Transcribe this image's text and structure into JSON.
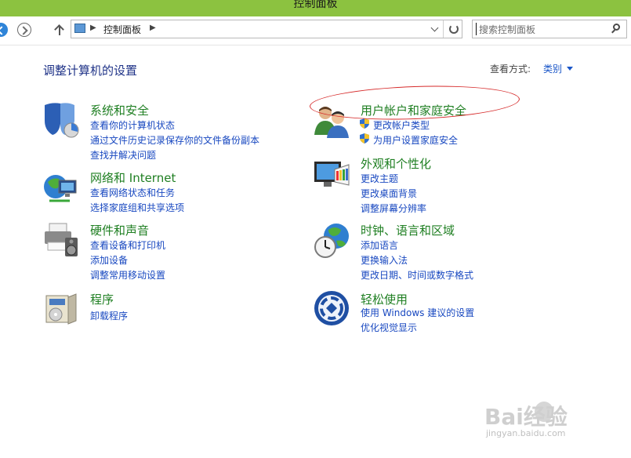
{
  "window": {
    "title": "控制面板"
  },
  "addressbar": {
    "breadcrumb": "控制面板",
    "search_placeholder": "搜索控制面板"
  },
  "page": {
    "heading": "调整计算机的设置",
    "view_by_label": "查看方式:",
    "view_by_value": "类别"
  },
  "categories": {
    "system_security": {
      "title": "系统和安全",
      "icon": "shield-icon",
      "links": [
        "查看你的计算机状态",
        "通过文件历史记录保存你的文件备份副本",
        "查找并解决问题"
      ]
    },
    "network_internet": {
      "title": "网络和 Internet",
      "icon": "network-globe-icon",
      "links": [
        "查看网络状态和任务",
        "选择家庭组和共享选项"
      ]
    },
    "hardware_sound": {
      "title": "硬件和声音",
      "icon": "printer-speaker-icon",
      "links": [
        "查看设备和打印机",
        "添加设备",
        "调整常用移动设置"
      ]
    },
    "programs": {
      "title": "程序",
      "icon": "programs-box-icon",
      "links": [
        "卸载程序"
      ]
    },
    "user_accounts": {
      "title": "用户帐户和家庭安全",
      "icon": "users-icon",
      "links": [
        "更改帐户类型",
        "为用户设置家庭安全"
      ]
    },
    "appearance": {
      "title": "外观和个性化",
      "icon": "monitor-palette-icon",
      "links": [
        "更改主题",
        "更改桌面背景",
        "调整屏幕分辨率"
      ]
    },
    "clock_region": {
      "title": "时钟、语言和区域",
      "icon": "clock-globe-icon",
      "links": [
        "添加语言",
        "更换输入法",
        "更改日期、时间或数字格式"
      ]
    },
    "ease_of_access": {
      "title": "轻松使用",
      "icon": "ease-of-access-icon",
      "links": [
        "使用 Windows 建议的设置",
        "优化视觉显示"
      ]
    }
  },
  "annotation_color": "#d62a2a",
  "watermark": {
    "brand": "Bai经验",
    "url": "jingyan.baidu.com"
  }
}
